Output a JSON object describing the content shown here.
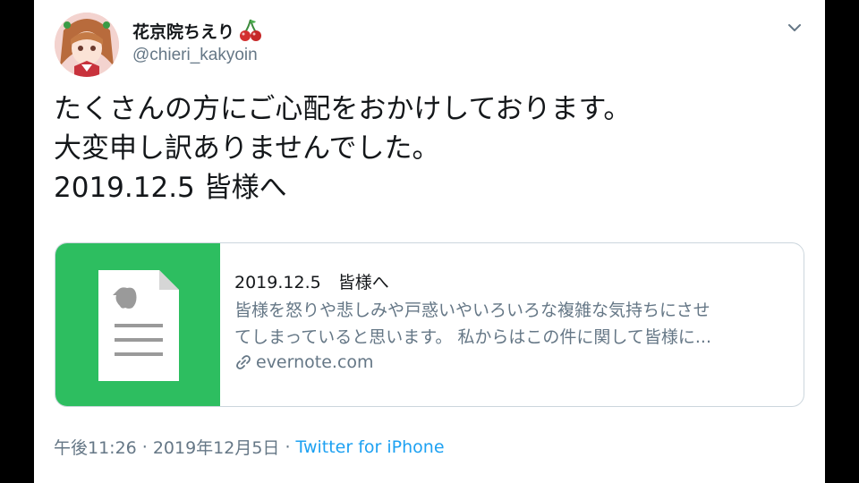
{
  "user": {
    "display_name": "花京院ちえり",
    "name_emoji": "cherry-icon",
    "handle": "@chieri_kakyoin"
  },
  "tweet": {
    "lines": [
      "たくさんの方にご心配をおかけしております。",
      "大変申し訳ありませんでした。",
      "2019.12.5 皆様へ"
    ]
  },
  "link_card": {
    "title": "2019.12.5　皆様へ",
    "description_lines": [
      "皆様を怒りや悲しみや戸惑いやいろいろな複雑な気持ちにさせ",
      "てしまっていると思います。 私からはこの件に関して皆様に..."
    ],
    "domain": "evernote.com",
    "thumb_icon": "evernote-document-icon",
    "thumb_color": "#2dbe60"
  },
  "meta": {
    "time": "午後11:26",
    "sep1": "·",
    "date": "2019年12月5日",
    "sep2": "·",
    "source": "Twitter for iPhone"
  },
  "colors": {
    "link_blue": "#1da1f2",
    "secondary_text": "#657786"
  }
}
